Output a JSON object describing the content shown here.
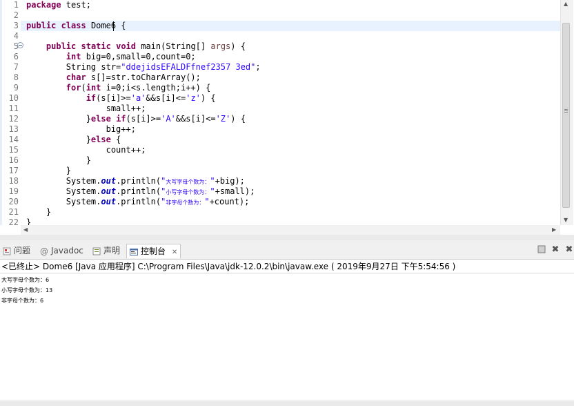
{
  "editor": {
    "line_numbers": [
      "1",
      "2",
      "3",
      "4",
      "5",
      "6",
      "7",
      "8",
      "9",
      "10",
      "11",
      "12",
      "13",
      "14",
      "15",
      "16",
      "17",
      "18",
      "19",
      "20",
      "21",
      "22"
    ],
    "lines": [
      [
        {
          "t": "package",
          "c": "kw"
        },
        {
          "t": " test;",
          "c": ""
        }
      ],
      [],
      [
        {
          "t": "public",
          "c": "kw"
        },
        {
          "t": " ",
          "c": ""
        },
        {
          "t": "class",
          "c": "kw"
        },
        {
          "t": " Dome6 {",
          "c": ""
        }
      ],
      [],
      [
        {
          "t": "    ",
          "c": ""
        },
        {
          "t": "public",
          "c": "kw"
        },
        {
          "t": " ",
          "c": ""
        },
        {
          "t": "static",
          "c": "kw"
        },
        {
          "t": " ",
          "c": ""
        },
        {
          "t": "void",
          "c": "kw"
        },
        {
          "t": " main(String[] ",
          "c": ""
        },
        {
          "t": "args",
          "c": "param"
        },
        {
          "t": ") {",
          "c": ""
        }
      ],
      [
        {
          "t": "        ",
          "c": ""
        },
        {
          "t": "int",
          "c": "kw"
        },
        {
          "t": " big=0,small=0,count=0;",
          "c": ""
        }
      ],
      [
        {
          "t": "        String str=",
          "c": ""
        },
        {
          "t": "\"ddejidsEFALDFfnef2357 3ed\"",
          "c": "str"
        },
        {
          "t": ";",
          "c": ""
        }
      ],
      [
        {
          "t": "        ",
          "c": ""
        },
        {
          "t": "char",
          "c": "kw"
        },
        {
          "t": " s[]=str.toCharArray();",
          "c": ""
        }
      ],
      [
        {
          "t": "        ",
          "c": ""
        },
        {
          "t": "for",
          "c": "kw"
        },
        {
          "t": "(",
          "c": ""
        },
        {
          "t": "int",
          "c": "kw"
        },
        {
          "t": " i=0;i<s.length;i++) {",
          "c": ""
        }
      ],
      [
        {
          "t": "            ",
          "c": ""
        },
        {
          "t": "if",
          "c": "kw"
        },
        {
          "t": "(s[i]>=",
          "c": ""
        },
        {
          "t": "'a'",
          "c": "str"
        },
        {
          "t": "&&s[i]<=",
          "c": ""
        },
        {
          "t": "'z'",
          "c": "str"
        },
        {
          "t": ") {",
          "c": ""
        }
      ],
      [
        {
          "t": "                small++;",
          "c": ""
        }
      ],
      [
        {
          "t": "            }",
          "c": ""
        },
        {
          "t": "else",
          "c": "kw"
        },
        {
          "t": " ",
          "c": ""
        },
        {
          "t": "if",
          "c": "kw"
        },
        {
          "t": "(s[i]>=",
          "c": ""
        },
        {
          "t": "'A'",
          "c": "str"
        },
        {
          "t": "&&s[i]<=",
          "c": ""
        },
        {
          "t": "'Z'",
          "c": "str"
        },
        {
          "t": ") {",
          "c": ""
        }
      ],
      [
        {
          "t": "                big++;",
          "c": ""
        }
      ],
      [
        {
          "t": "            }",
          "c": ""
        },
        {
          "t": "else",
          "c": "kw"
        },
        {
          "t": " {",
          "c": ""
        }
      ],
      [
        {
          "t": "                count++;",
          "c": ""
        }
      ],
      [
        {
          "t": "            }",
          "c": ""
        }
      ],
      [
        {
          "t": "        }",
          "c": ""
        }
      ],
      [
        {
          "t": "        System.",
          "c": ""
        },
        {
          "t": "out",
          "c": "fieldI"
        },
        {
          "t": ".println(",
          "c": ""
        },
        {
          "t": "\"",
          "c": "str"
        },
        {
          "t": "大写字母个数为：",
          "c": "str cjk"
        },
        {
          "t": "\"",
          "c": "str"
        },
        {
          "t": "+big);",
          "c": ""
        }
      ],
      [
        {
          "t": "        System.",
          "c": ""
        },
        {
          "t": "out",
          "c": "fieldI"
        },
        {
          "t": ".println(",
          "c": ""
        },
        {
          "t": "\"",
          "c": "str"
        },
        {
          "t": "小写字母个数为：",
          "c": "str cjk"
        },
        {
          "t": "\"",
          "c": "str"
        },
        {
          "t": "+small);",
          "c": ""
        }
      ],
      [
        {
          "t": "        System.",
          "c": ""
        },
        {
          "t": "out",
          "c": "fieldI"
        },
        {
          "t": ".println(",
          "c": ""
        },
        {
          "t": "\"",
          "c": "str"
        },
        {
          "t": "非字母个数为：",
          "c": "str cjk"
        },
        {
          "t": "\"",
          "c": "str"
        },
        {
          "t": "+count);",
          "c": ""
        }
      ],
      [
        {
          "t": "    }",
          "c": ""
        }
      ],
      [
        {
          "t": "}",
          "c": ""
        }
      ]
    ]
  },
  "console": {
    "tabs": {
      "problems": "问题",
      "javadoc": "Javadoc",
      "declaration": "声明",
      "console": "控制台"
    },
    "status": "<已终止> Dome6 [Java 应用程序] C:\\Program Files\\Java\\jdk-12.0.2\\bin\\javaw.exe ( 2019年9月27日 下午5:54:56 )",
    "output": [
      "大写字母个数为：6",
      "小写字母个数为：13",
      "非字母个数为：6"
    ]
  },
  "icons": {
    "problems": "problems-icon",
    "javadoc": "at-sign-icon",
    "declaration": "declaration-icon",
    "console": "console-icon",
    "close": "close-icon",
    "minimize": "minimize-icon",
    "maximize": "maximize-icon",
    "clear": "remove-launch-icon"
  },
  "colors": {
    "keyword": "#7f0055",
    "string": "#2a00ff",
    "field": "#0000c0",
    "line_highlight": "#e8f2fe"
  }
}
